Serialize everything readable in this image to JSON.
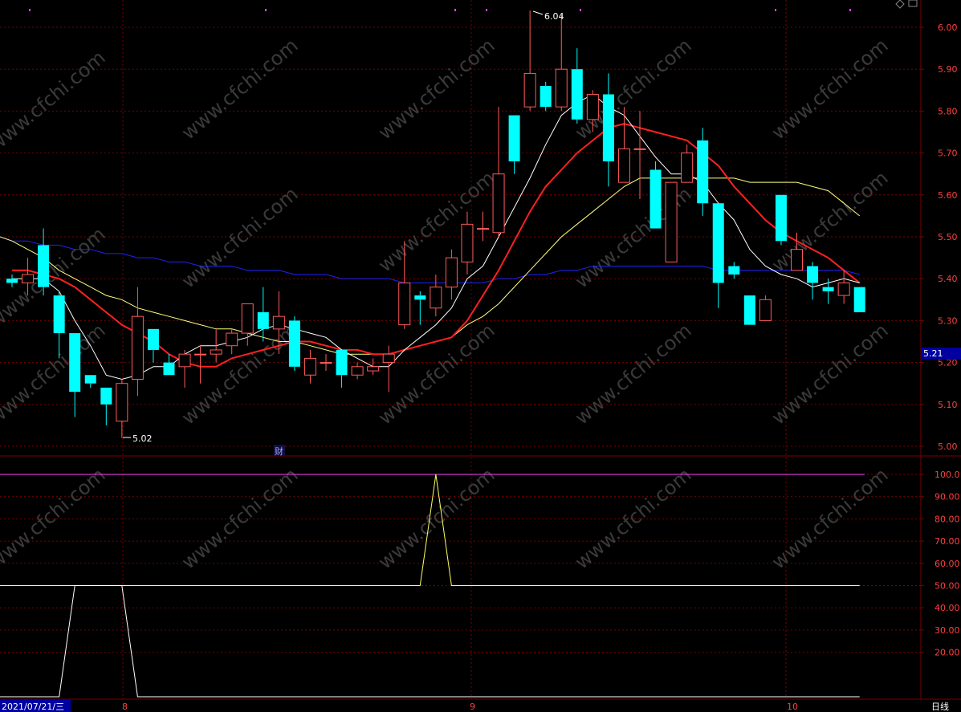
{
  "main_price_axis": [
    "6.00",
    "5.90",
    "5.80",
    "5.70",
    "5.60",
    "5.50",
    "5.40",
    "5.30",
    "5.20",
    "5.10",
    "5.00"
  ],
  "current_price_tag": "5.21",
  "high_annotation": "6.04",
  "low_annotation": "5.02",
  "finance_marker": "财",
  "indicator_axis": [
    "100.0",
    "90.00",
    "80.00",
    "70.00",
    "60.00",
    "50.00",
    "40.00",
    "30.00",
    "20.00"
  ],
  "date_start": "2021/07/21/三",
  "month_labels": [
    "8",
    "9",
    "10"
  ],
  "period_label": "日线",
  "watermark": "www.cfchi.com",
  "colors": {
    "up": "#ff5a5a",
    "down": "#00ffff",
    "grid": "#7a0000",
    "ma5": "#ffffff",
    "ma10": "#ff2020",
    "ma20": "#ffff80",
    "ma60": "#2020ff",
    "ind_ref": "#ff40ff",
    "ind_yellow": "#ffff60",
    "ind_white": "#ffffff"
  },
  "chart_data": {
    "type": "candlestick",
    "ylim": [
      4.95,
      6.06
    ],
    "candles": [
      {
        "o": 5.4,
        "h": 5.41,
        "l": 5.38,
        "c": 5.39
      },
      {
        "o": 5.39,
        "h": 5.45,
        "l": 5.36,
        "c": 5.41
      },
      {
        "o": 5.48,
        "h": 5.52,
        "l": 5.36,
        "c": 5.38
      },
      {
        "o": 5.36,
        "h": 5.37,
        "l": 5.21,
        "c": 5.27
      },
      {
        "o": 5.27,
        "h": 5.27,
        "l": 5.07,
        "c": 5.13
      },
      {
        "o": 5.17,
        "h": 5.17,
        "l": 5.14,
        "c": 5.15
      },
      {
        "o": 5.14,
        "h": 5.14,
        "l": 5.05,
        "c": 5.1
      },
      {
        "o": 5.06,
        "h": 5.16,
        "l": 5.02,
        "c": 5.15
      },
      {
        "o": 5.16,
        "h": 5.38,
        "l": 5.12,
        "c": 5.31
      },
      {
        "o": 5.28,
        "h": 5.28,
        "l": 5.2,
        "c": 5.23
      },
      {
        "o": 5.2,
        "h": 5.22,
        "l": 5.17,
        "c": 5.17
      },
      {
        "o": 5.19,
        "h": 5.23,
        "l": 5.14,
        "c": 5.22
      },
      {
        "o": 5.22,
        "h": 5.24,
        "l": 5.15,
        "c": 5.22
      },
      {
        "o": 5.22,
        "h": 5.28,
        "l": 5.2,
        "c": 5.23
      },
      {
        "o": 5.24,
        "h": 5.28,
        "l": 5.22,
        "c": 5.27
      },
      {
        "o": 5.27,
        "h": 5.34,
        "l": 5.24,
        "c": 5.34
      },
      {
        "o": 5.32,
        "h": 5.38,
        "l": 5.25,
        "c": 5.28
      },
      {
        "o": 5.28,
        "h": 5.37,
        "l": 5.22,
        "c": 5.31
      },
      {
        "o": 5.3,
        "h": 5.31,
        "l": 5.18,
        "c": 5.19
      },
      {
        "o": 5.17,
        "h": 5.23,
        "l": 5.15,
        "c": 5.21
      },
      {
        "o": 5.2,
        "h": 5.22,
        "l": 5.18,
        "c": 5.2
      },
      {
        "o": 5.23,
        "h": 5.23,
        "l": 5.14,
        "c": 5.17
      },
      {
        "o": 5.17,
        "h": 5.2,
        "l": 5.16,
        "c": 5.19
      },
      {
        "o": 5.18,
        "h": 5.21,
        "l": 5.17,
        "c": 5.19
      },
      {
        "o": 5.2,
        "h": 5.24,
        "l": 5.13,
        "c": 5.22
      },
      {
        "o": 5.29,
        "h": 5.49,
        "l": 5.28,
        "c": 5.39
      },
      {
        "o": 5.36,
        "h": 5.37,
        "l": 5.29,
        "c": 5.35
      },
      {
        "o": 5.33,
        "h": 5.41,
        "l": 5.31,
        "c": 5.38
      },
      {
        "o": 5.38,
        "h": 5.47,
        "l": 5.35,
        "c": 5.45
      },
      {
        "o": 5.44,
        "h": 5.56,
        "l": 5.41,
        "c": 5.53
      },
      {
        "o": 5.52,
        "h": 5.56,
        "l": 5.49,
        "c": 5.52
      },
      {
        "o": 5.51,
        "h": 5.81,
        "l": 5.5,
        "c": 5.65
      },
      {
        "o": 5.79,
        "h": 5.79,
        "l": 5.65,
        "c": 5.68
      },
      {
        "o": 5.81,
        "h": 6.04,
        "l": 5.8,
        "c": 5.89
      },
      {
        "o": 5.86,
        "h": 5.87,
        "l": 5.8,
        "c": 5.81
      },
      {
        "o": 5.81,
        "h": 6.03,
        "l": 5.8,
        "c": 5.9
      },
      {
        "o": 5.9,
        "h": 5.95,
        "l": 5.77,
        "c": 5.78
      },
      {
        "o": 5.78,
        "h": 5.85,
        "l": 5.75,
        "c": 5.84
      },
      {
        "o": 5.84,
        "h": 5.89,
        "l": 5.62,
        "c": 5.68
      },
      {
        "o": 5.63,
        "h": 5.81,
        "l": 5.63,
        "c": 5.71
      },
      {
        "o": 5.71,
        "h": 5.8,
        "l": 5.59,
        "c": 5.71
      },
      {
        "o": 5.66,
        "h": 5.68,
        "l": 5.52,
        "c": 5.52
      },
      {
        "o": 5.44,
        "h": 5.63,
        "l": 5.44,
        "c": 5.63
      },
      {
        "o": 5.63,
        "h": 5.72,
        "l": 5.63,
        "c": 5.7
      },
      {
        "o": 5.73,
        "h": 5.76,
        "l": 5.55,
        "c": 5.58
      },
      {
        "o": 5.58,
        "h": 5.58,
        "l": 5.33,
        "c": 5.39
      },
      {
        "o": 5.43,
        "h": 5.44,
        "l": 5.4,
        "c": 5.41
      },
      {
        "o": 5.36,
        "h": 5.36,
        "l": 5.29,
        "c": 5.29
      },
      {
        "o": 5.3,
        "h": 5.36,
        "l": 5.3,
        "c": 5.35
      },
      {
        "o": 5.6,
        "h": 5.6,
        "l": 5.48,
        "c": 5.49
      },
      {
        "o": 5.42,
        "h": 5.51,
        "l": 5.42,
        "c": 5.47
      },
      {
        "o": 5.43,
        "h": 5.44,
        "l": 5.35,
        "c": 5.39
      },
      {
        "o": 5.38,
        "h": 5.4,
        "l": 5.34,
        "c": 5.37
      },
      {
        "o": 5.36,
        "h": 5.42,
        "l": 5.34,
        "c": 5.39
      },
      {
        "o": 5.38,
        "h": 5.38,
        "l": 5.32,
        "c": 5.32
      }
    ],
    "ma5": [
      5.4,
      5.4,
      5.4,
      5.37,
      5.3,
      5.24,
      5.17,
      5.16,
      5.17,
      5.19,
      5.19,
      5.22,
      5.24,
      5.24,
      5.25,
      5.26,
      5.28,
      5.29,
      5.28,
      5.27,
      5.26,
      5.23,
      5.21,
      5.19,
      5.19,
      5.23,
      5.26,
      5.29,
      5.33,
      5.4,
      5.43,
      5.5,
      5.57,
      5.64,
      5.72,
      5.79,
      5.82,
      5.84,
      5.81,
      5.79,
      5.74,
      5.69,
      5.65,
      5.65,
      5.63,
      5.58,
      5.54,
      5.47,
      5.43,
      5.41,
      5.4,
      5.38,
      5.39,
      5.4,
      5.39
    ],
    "ma10": [
      5.42,
      5.42,
      5.41,
      5.4,
      5.38,
      5.35,
      5.32,
      5.29,
      5.27,
      5.25,
      5.22,
      5.2,
      5.19,
      5.19,
      5.21,
      5.22,
      5.23,
      5.24,
      5.25,
      5.25,
      5.24,
      5.23,
      5.23,
      5.22,
      5.22,
      5.23,
      5.24,
      5.25,
      5.26,
      5.3,
      5.36,
      5.42,
      5.49,
      5.56,
      5.62,
      5.66,
      5.7,
      5.73,
      5.76,
      5.77,
      5.76,
      5.75,
      5.74,
      5.73,
      5.7,
      5.67,
      5.62,
      5.58,
      5.54,
      5.51,
      5.49,
      5.47,
      5.45,
      5.42,
      5.39
    ],
    "ma20": [
      5.49,
      5.47,
      5.45,
      5.42,
      5.4,
      5.38,
      5.36,
      5.35,
      5.33,
      5.32,
      5.31,
      5.3,
      5.29,
      5.28,
      5.28,
      5.27,
      5.26,
      5.25,
      5.25,
      5.24,
      5.23,
      5.22,
      5.22,
      5.22,
      5.22,
      5.23,
      5.24,
      5.25,
      5.26,
      5.29,
      5.31,
      5.34,
      5.38,
      5.42,
      5.46,
      5.5,
      5.53,
      5.56,
      5.59,
      5.62,
      5.64,
      5.64,
      5.64,
      5.64,
      5.64,
      5.64,
      5.64,
      5.63,
      5.63,
      5.63,
      5.63,
      5.62,
      5.61,
      5.58,
      5.55
    ],
    "ma60": [
      5.49,
      5.49,
      5.48,
      5.48,
      5.47,
      5.47,
      5.46,
      5.46,
      5.45,
      5.45,
      5.44,
      5.44,
      5.43,
      5.43,
      5.43,
      5.42,
      5.42,
      5.42,
      5.41,
      5.41,
      5.41,
      5.4,
      5.4,
      5.4,
      5.4,
      5.39,
      5.39,
      5.39,
      5.39,
      5.39,
      5.39,
      5.4,
      5.4,
      5.41,
      5.41,
      5.42,
      5.42,
      5.43,
      5.43,
      5.43,
      5.43,
      5.43,
      5.43,
      5.43,
      5.43,
      5.42,
      5.42,
      5.42,
      5.42,
      5.42,
      5.42,
      5.42,
      5.42,
      5.42,
      5.41
    ],
    "indicator": {
      "ylim": [
        0,
        100
      ],
      "ref_value": 100,
      "yellow": [
        50,
        50,
        50,
        50,
        50,
        50,
        50,
        50,
        50,
        50,
        50,
        50,
        50,
        50,
        50,
        50,
        50,
        50,
        50,
        50,
        50,
        50,
        50,
        50,
        50,
        50,
        50,
        100,
        50,
        50,
        50,
        50,
        50,
        50,
        50,
        50,
        50,
        50,
        50,
        50,
        50,
        50,
        50,
        50,
        50,
        50,
        50,
        50,
        50,
        50,
        50,
        50,
        50,
        50,
        50
      ],
      "white": [
        0,
        0,
        0,
        0,
        50,
        50,
        50,
        50,
        0,
        0,
        0,
        0,
        0,
        0,
        0,
        0,
        0,
        0,
        0,
        0,
        0,
        0,
        0,
        0,
        0,
        0,
        0,
        0,
        0,
        0,
        0,
        0,
        0,
        0,
        0,
        0,
        0,
        0,
        0,
        0,
        0,
        0,
        0,
        0,
        0,
        0,
        0,
        0,
        0,
        0,
        0,
        0,
        0,
        0,
        0
      ]
    }
  }
}
